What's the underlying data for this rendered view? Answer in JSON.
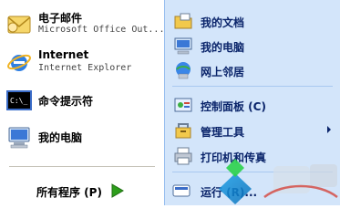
{
  "left": {
    "pinned": [
      {
        "title": "电子邮件",
        "subtitle": "Microsoft Office Out..."
      },
      {
        "title": "Internet",
        "subtitle": "Internet Explorer"
      }
    ],
    "recent": [
      {
        "title": "命令提示符"
      },
      {
        "title": "我的电脑"
      }
    ],
    "all_programs": "所有程序 (P)"
  },
  "right": {
    "items": [
      {
        "label": "我的文档"
      },
      {
        "label": "我的电脑"
      },
      {
        "label": "网上邻居"
      },
      {
        "label": "控制面板 (C)"
      },
      {
        "label": "管理工具"
      },
      {
        "label": "打印机和传真"
      },
      {
        "label": "运行 (R)..."
      }
    ]
  },
  "colors": {
    "right_bg": "#d3e5fa",
    "right_text": "#0a246a",
    "accent_green": "#2d9e1b"
  },
  "icons": {
    "email": "email-icon",
    "ie": "internet-explorer-icon",
    "cmd": "command-prompt-icon",
    "computer": "my-computer-icon",
    "documents": "my-documents-icon",
    "network": "network-places-icon",
    "control": "control-panel-icon",
    "admin": "admin-tools-icon",
    "printer": "printer-icon",
    "run": "run-icon"
  }
}
